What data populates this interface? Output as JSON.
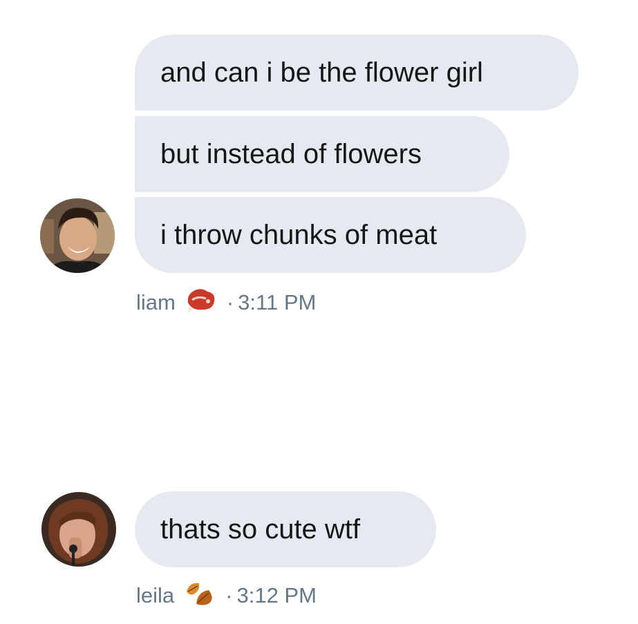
{
  "messages": [
    {
      "sender": "liam",
      "text": "and can i be the flower girl"
    },
    {
      "sender": "liam",
      "text": "but instead of flowers"
    },
    {
      "sender": "liam",
      "text": "i throw chunks of meat"
    },
    {
      "sender": "leila",
      "text": "thats so cute wtf"
    }
  ],
  "groups": [
    {
      "name": "liam",
      "emoji_icon": "meat-icon",
      "separator": "·",
      "time": "3:11 PM"
    },
    {
      "name": "leila",
      "emoji_icon": "fallen-leaf-icon",
      "separator": "·",
      "time": "3:12 PM"
    }
  ],
  "colors": {
    "bubble_bg": "#e6e9ef",
    "bubble_text": "#14171a",
    "meta_text": "#657786"
  }
}
